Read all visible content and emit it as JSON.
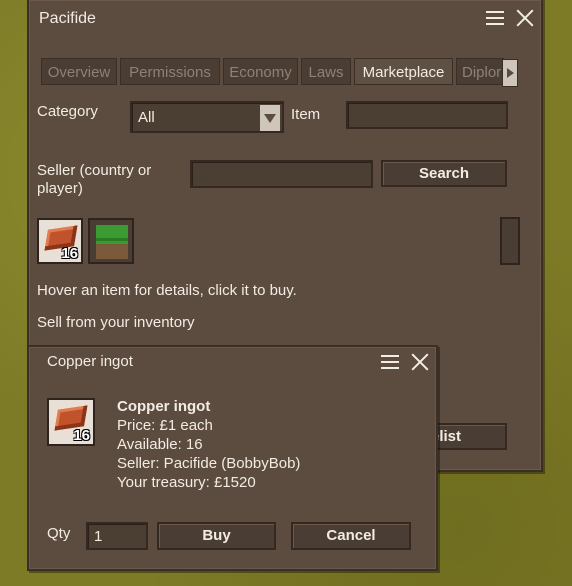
{
  "main_window": {
    "title": "Pacifide",
    "tabs": [
      {
        "label": "Overview",
        "active": false
      },
      {
        "label": "Permissions",
        "active": false
      },
      {
        "label": "Economy",
        "active": false
      },
      {
        "label": "Laws",
        "active": false
      },
      {
        "label": "Marketplace",
        "active": true
      },
      {
        "label": "Diplor",
        "active": false
      }
    ],
    "category_label": "Category",
    "category_value": "All",
    "item_label": "Item",
    "item_value": "",
    "seller_label": "Seller (country or player)",
    "seller_value": "",
    "search_button": "Search",
    "items": [
      {
        "icon": "copper-ingot-icon",
        "count": "16",
        "selected": true
      },
      {
        "icon": "grass-block-icon",
        "count": "",
        "selected": false
      }
    ],
    "hint": "Hover an item for details, click it to buy.",
    "sell_label": "Sell from your inventory",
    "partial_button": "elist"
  },
  "popup": {
    "title": "Copper ingot",
    "item_name": "Copper ingot",
    "item_count": "16",
    "price": "Price: £1 each",
    "available": "Available: 16",
    "seller": "Seller: Pacifide (BobbyBob)",
    "treasury": "Your treasury: £1520",
    "qty_label": "Qty",
    "qty_value": "1",
    "buy_button": "Buy",
    "cancel_button": "Cancel"
  }
}
